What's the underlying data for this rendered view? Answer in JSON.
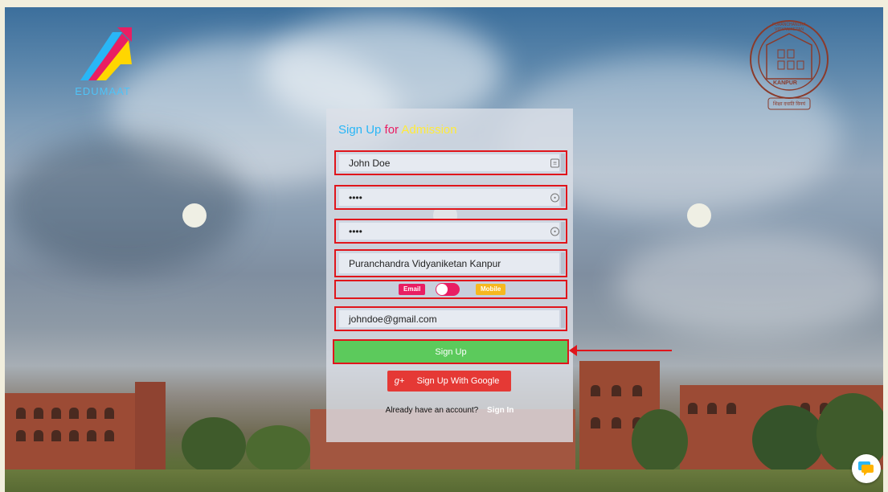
{
  "brand": {
    "left_logo_text": "EDUMAAT",
    "right_logo_label": "KANPUR",
    "right_logo_ring_text": "PURANCHANDRA VIDYANIKETAN",
    "right_logo_motto": "शिक्षा दधाति विनयं"
  },
  "form": {
    "title_part1": "Sign Up",
    "title_part2": "for",
    "title_part3": "Admission",
    "name_value": "John Doe",
    "password_value": "••••",
    "confirm_password_value": "••••",
    "school_value": "Puranchandra Vidyaniketan Kanpur",
    "toggle_left_label": "Email",
    "toggle_right_label": "Mobile",
    "email_value": "johndoe@gmail.com",
    "signup_label": "Sign Up",
    "google_icon": "g+",
    "google_label": "Sign Up With Google",
    "account_prompt": "Already have an account?",
    "signin_label": "Sign In"
  },
  "icons": {
    "name_field": "contact-card-icon",
    "password_field": "key-icon",
    "confirm_field": "key-icon",
    "chat": "chat-bubble-icon"
  },
  "colors": {
    "accent_blue": "#29b6f6",
    "accent_pink": "#e91e63",
    "accent_yellow": "#ffeb3b",
    "signup_green": "#5cca5c",
    "google_red": "#e53935",
    "highlight_red": "#e0151b"
  }
}
